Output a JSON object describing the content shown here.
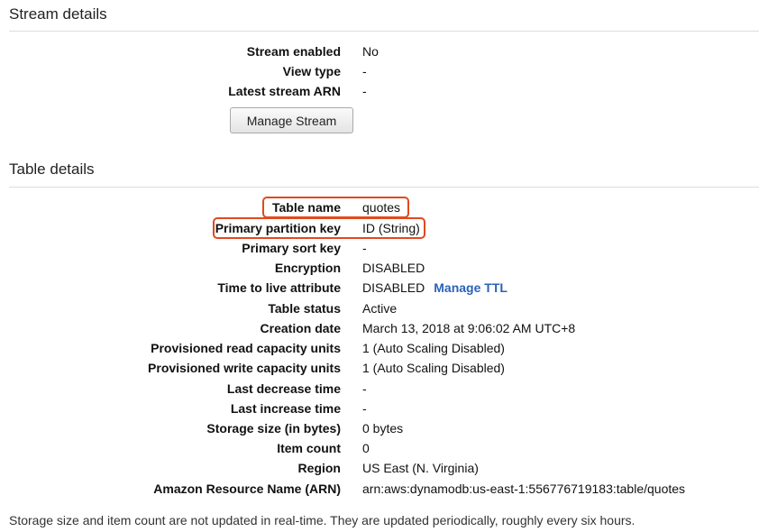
{
  "stream": {
    "title": "Stream details",
    "rows": [
      {
        "label": "Stream enabled",
        "value": "No"
      },
      {
        "label": "View type",
        "value": "-"
      },
      {
        "label": "Latest stream ARN",
        "value": "-"
      }
    ],
    "manage_button": "Manage Stream"
  },
  "table": {
    "title": "Table details",
    "rows": [
      {
        "label": "Table name",
        "value": "quotes"
      },
      {
        "label": "Primary partition key",
        "value": "ID (String)"
      },
      {
        "label": "Primary sort key",
        "value": "-"
      },
      {
        "label": "Encryption",
        "value": "DISABLED"
      },
      {
        "label": "Time to live attribute",
        "value": "DISABLED",
        "link": "Manage TTL"
      },
      {
        "label": "Table status",
        "value": "Active"
      },
      {
        "label": "Creation date",
        "value": "March 13, 2018 at 9:06:02 AM UTC+8"
      },
      {
        "label": "Provisioned read capacity units",
        "value": "1 (Auto Scaling Disabled)"
      },
      {
        "label": "Provisioned write capacity units",
        "value": "1 (Auto Scaling Disabled)"
      },
      {
        "label": "Last decrease time",
        "value": "-"
      },
      {
        "label": "Last increase time",
        "value": "-"
      },
      {
        "label": "Storage size (in bytes)",
        "value": "0 bytes"
      },
      {
        "label": "Item count",
        "value": "0"
      },
      {
        "label": "Region",
        "value": "US East (N. Virginia)"
      },
      {
        "label": "Amazon Resource Name (ARN)",
        "value": "arn:aws:dynamodb:us-east-1:556776719183:table/quotes"
      }
    ]
  },
  "footnote": "Storage size and item count are not updated in real-time. They are updated periodically, roughly every six hours.",
  "colors": {
    "highlight": "#e2491e",
    "link": "#2a62b8"
  }
}
